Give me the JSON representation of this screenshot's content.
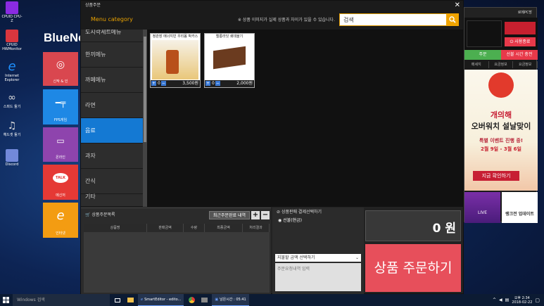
{
  "desktop": {
    "brand": "BlueNet",
    "icons": [
      {
        "label": "CPUID CPU-Z",
        "color": "#8a2be2"
      },
      {
        "label": "CPUID HWMonitor",
        "color": "#d9363e"
      },
      {
        "label": "Internet Explorer",
        "color": "#1e90ff"
      },
      {
        "label": "스피드 둘기",
        "color": "#888888"
      },
      {
        "label": "헤드셋 둘기",
        "color": "#666666"
      },
      {
        "label": "Discord",
        "color": "#7289da"
      }
    ],
    "tiles": [
      {
        "label": "신작 & 인",
        "color": "#d9474f"
      },
      {
        "label": "FPS게임",
        "color": "#1e88e5"
      },
      {
        "label": "온라인",
        "color": "#8e44ad"
      },
      {
        "label": "메신저",
        "color": "#e53935"
      },
      {
        "label": "인터넷",
        "color": "#f39c12"
      }
    ],
    "tile_badges": [
      "TALK"
    ]
  },
  "dialog": {
    "title": "상품주문",
    "close": "✕",
    "category_header": "Menu category",
    "search_notice": "※ 상품 이미지가 실제 상품과 차이가 있을 수 있습니다.",
    "search_value": "검색",
    "categories": [
      {
        "label": "도시락세트메뉴",
        "active": false,
        "cut": true
      },
      {
        "label": "한끼메뉴",
        "active": false
      },
      {
        "label": "까페메뉴",
        "active": false
      },
      {
        "label": "라면",
        "active": false
      },
      {
        "label": "음료",
        "active": true
      },
      {
        "label": "과자",
        "active": false
      },
      {
        "label": "간식",
        "active": false
      },
      {
        "label": "기타",
        "active": false,
        "cut": true
      }
    ],
    "products": [
      {
        "name": "정관장 에너지빈 우리몸 박카스",
        "qty": "0",
        "price": "3,500원"
      },
      {
        "name": "엘롱라잇 쇄데울기",
        "qty": "0",
        "price": "2,000원"
      }
    ],
    "order": {
      "title": "상품주문목록",
      "recent_button": "최근주문완료 내역",
      "plus": "+",
      "minus": "−",
      "columns": [
        "상품명",
        "판매금액",
        "수량",
        "최종금액",
        "처리결과"
      ]
    },
    "payment": {
      "title": "상품판매 결제선택하기",
      "option": "선불(현금)",
      "select_placeholder": "지불할 금액 선택하기",
      "memo_placeholder": "주문요청내역 입력"
    },
    "total": "0 원",
    "order_button": "상품 주문하기"
  },
  "pcpanel": {
    "top": "로메PC방",
    "logout": "사용종료",
    "tabs": [
      "주문",
      "선불 시간 충전"
    ],
    "tab_colors": [
      "#4caf50",
      "#e8394a"
    ],
    "links": [
      "메세지",
      "요금정보",
      "요금정보"
    ],
    "ad": {
      "title1": "개의해",
      "title2": "오버워치 설날맞이",
      "title3": "특별 이벤트 진행 중!",
      "dates": "2월 9일 - 3월 6일",
      "cta": "지금 확인하기"
    },
    "bottom": [
      "LIVE",
      "랭크전 업데이트"
    ]
  },
  "taskbar": {
    "search_placeholder": "Windows 검색",
    "apps": [
      "SmartEditor - edito...",
      "남은시간 : 05:41"
    ],
    "time": "오후 2:34",
    "date": "2018-02-22"
  }
}
